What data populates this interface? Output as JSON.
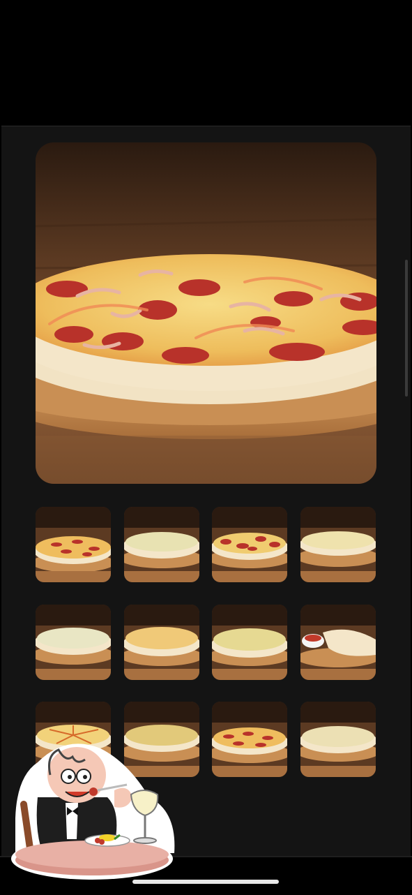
{
  "gallery": {
    "hero": {
      "alt": "pizza-with-salami-and-bacon"
    },
    "thumbnails": [
      {
        "variant": "salami"
      },
      {
        "variant": "cheese"
      },
      {
        "variant": "salami"
      },
      {
        "variant": "cheese"
      },
      {
        "variant": "cheese"
      },
      {
        "variant": "golden"
      },
      {
        "variant": "cheese"
      },
      {
        "variant": "calzone"
      },
      {
        "variant": "sauce-lines"
      },
      {
        "variant": "cheese"
      },
      {
        "variant": "salami"
      },
      {
        "variant": "cheese"
      }
    ]
  },
  "badge": {
    "icon": "diner-eating-icon"
  },
  "colors": {
    "background": "#000000",
    "panel": "#141414",
    "crust": "#f4e6c9",
    "cheese": "#f2d27a",
    "salami": "#b8322a",
    "wood": "#b7824f"
  }
}
